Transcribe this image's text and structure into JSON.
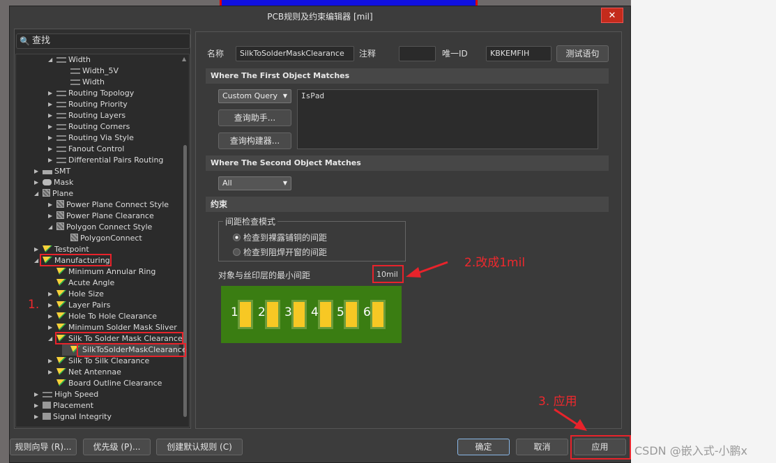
{
  "window": {
    "title": "PCB规则及约束编辑器 [mil]",
    "close_icon": "close-icon"
  },
  "search": {
    "placeholder": "查找"
  },
  "tree": [
    {
      "level": 2,
      "state": "open",
      "icon": "width",
      "label": "Width"
    },
    {
      "level": 3,
      "state": "none",
      "icon": "width",
      "label": "Width_5V"
    },
    {
      "level": 3,
      "state": "none",
      "icon": "width",
      "label": "Width"
    },
    {
      "level": 2,
      "state": "closed",
      "icon": "width",
      "label": "Routing Topology"
    },
    {
      "level": 2,
      "state": "closed",
      "icon": "width",
      "label": "Routing Priority"
    },
    {
      "level": 2,
      "state": "closed",
      "icon": "width",
      "label": "Routing Layers"
    },
    {
      "level": 2,
      "state": "closed",
      "icon": "width",
      "label": "Routing Corners"
    },
    {
      "level": 2,
      "state": "closed",
      "icon": "width",
      "label": "Routing Via Style"
    },
    {
      "level": 2,
      "state": "closed",
      "icon": "width",
      "label": "Fanout Control"
    },
    {
      "level": 2,
      "state": "closed",
      "icon": "width",
      "label": "Differential Pairs Routing"
    },
    {
      "level": 1,
      "state": "closed",
      "icon": "smt",
      "label": "SMT"
    },
    {
      "level": 1,
      "state": "closed",
      "icon": "mask",
      "label": "Mask"
    },
    {
      "level": 1,
      "state": "open",
      "icon": "plane",
      "label": "Plane"
    },
    {
      "level": 2,
      "state": "closed",
      "icon": "plane",
      "label": "Power Plane Connect Style"
    },
    {
      "level": 2,
      "state": "closed",
      "icon": "plane",
      "label": "Power Plane Clearance"
    },
    {
      "level": 2,
      "state": "open",
      "icon": "plane",
      "label": "Polygon Connect Style"
    },
    {
      "level": 3,
      "state": "none",
      "icon": "plane",
      "label": "PolygonConnect"
    },
    {
      "level": 1,
      "state": "closed",
      "icon": "rule",
      "label": "Testpoint"
    },
    {
      "level": 1,
      "state": "open",
      "icon": "rule",
      "label": "Manufacturing"
    },
    {
      "level": 2,
      "state": "none",
      "icon": "rule",
      "label": "Minimum Annular Ring"
    },
    {
      "level": 2,
      "state": "none",
      "icon": "rule",
      "label": "Acute Angle"
    },
    {
      "level": 2,
      "state": "closed",
      "icon": "rule",
      "label": "Hole Size"
    },
    {
      "level": 2,
      "state": "closed",
      "icon": "rule",
      "label": "Layer Pairs"
    },
    {
      "level": 2,
      "state": "closed",
      "icon": "rule",
      "label": "Hole To Hole Clearance"
    },
    {
      "level": 2,
      "state": "closed",
      "icon": "rule",
      "label": "Minimum Solder Mask Sliver"
    },
    {
      "level": 2,
      "state": "open",
      "icon": "rule",
      "label": "Silk To Solder Mask Clearance"
    },
    {
      "level": 3,
      "state": "none",
      "icon": "rule",
      "label": "SilkToSolderMaskClearance",
      "selected": true
    },
    {
      "level": 2,
      "state": "closed",
      "icon": "rule",
      "label": "Silk To Silk Clearance"
    },
    {
      "level": 2,
      "state": "closed",
      "icon": "rule",
      "label": "Net Antennae"
    },
    {
      "level": 2,
      "state": "none",
      "icon": "rule",
      "label": "Board Outline Clearance"
    },
    {
      "level": 1,
      "state": "closed",
      "icon": "width",
      "label": "High Speed"
    },
    {
      "level": 1,
      "state": "closed",
      "icon": "bar",
      "label": "Placement"
    },
    {
      "level": 1,
      "state": "closed",
      "icon": "bar",
      "label": "Signal Integrity"
    }
  ],
  "rule": {
    "name_label": "名称",
    "name_value": "SilkToSolderMaskClearance",
    "comment_label": "注释",
    "comment_value": "",
    "uid_label": "唯一ID",
    "uid_value": "KBKEMFIH",
    "test_button": "测试语句"
  },
  "first": {
    "header": "Where The First Object Matches",
    "combo": "Custom Query",
    "helper_button": "查询助手...",
    "builder_button": "查询构建器...",
    "query": "IsPad"
  },
  "second": {
    "header": "Where The Second Object Matches",
    "combo": "All"
  },
  "constraint": {
    "header": "约束",
    "group_label": "间距检查模式",
    "radio1": "检查到裸露铺铜的间距",
    "radio2": "检查到阻焊开窗的间距",
    "radio_selected": 1,
    "min_label": "对象与丝印层的最小间距",
    "min_value": "10mil",
    "pads": [
      "1",
      "2",
      "3",
      "4",
      "5",
      "6"
    ]
  },
  "footer": {
    "wizard": "规则向导 (R)...",
    "priority": "优先级 (P)...",
    "default": "创建默认规则 (C)",
    "ok": "确定",
    "cancel": "取消",
    "apply": "应用"
  },
  "annotations": {
    "step1": "1.",
    "step2": "2.改成1mil",
    "step3": "3. 应用",
    "color": "#e8232b"
  },
  "watermark": "CSDN @嵌入式-小鹏x"
}
